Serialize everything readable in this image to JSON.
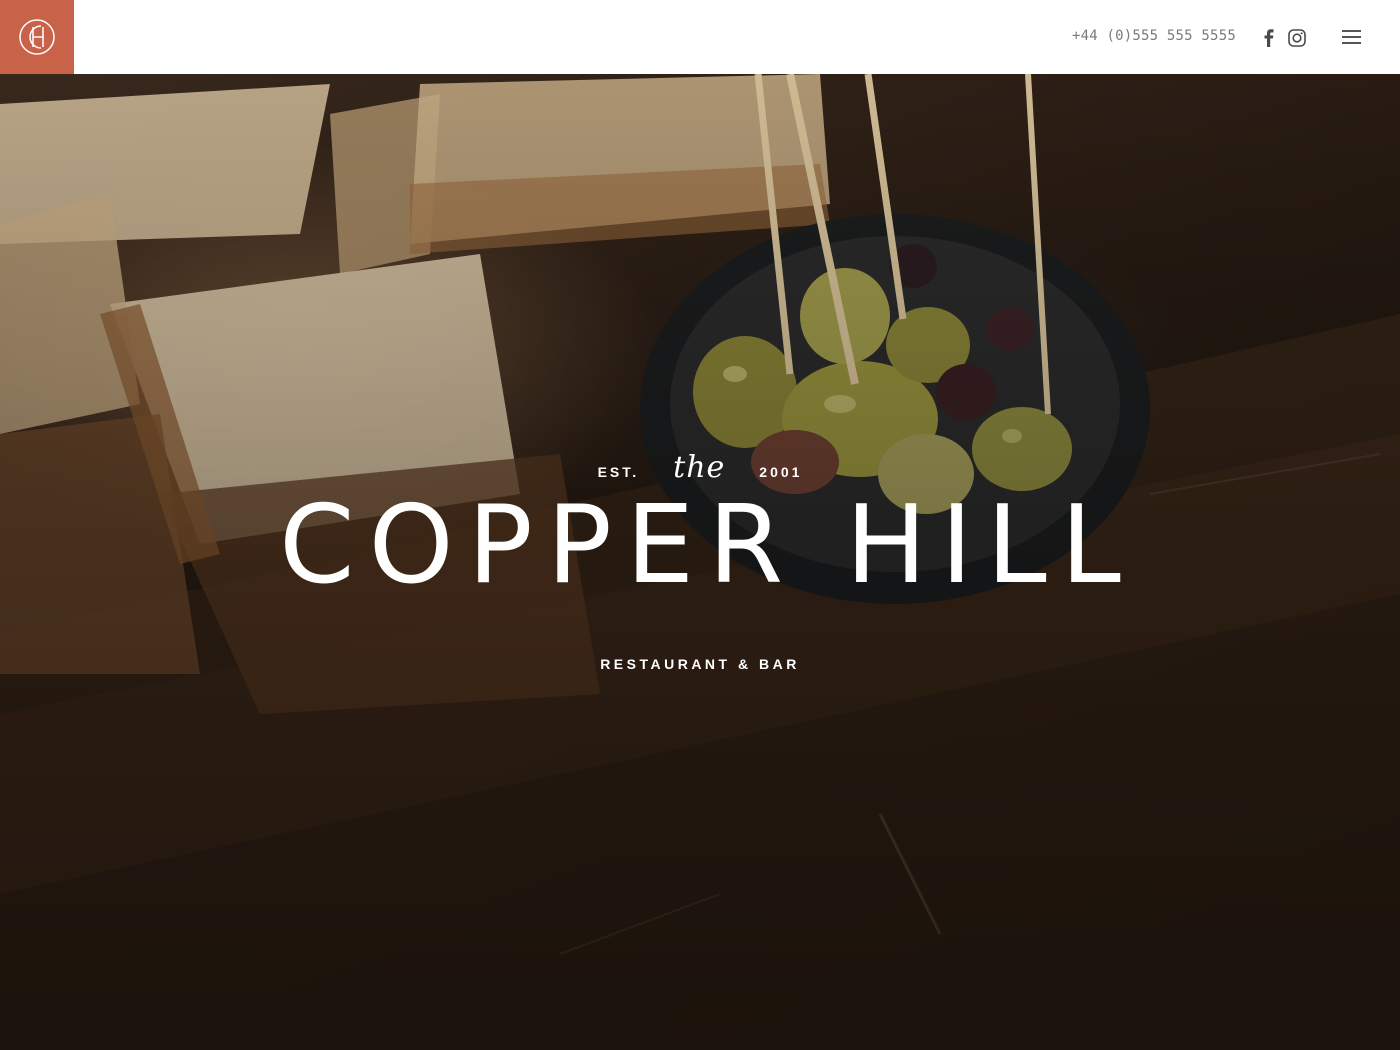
{
  "header": {
    "logo_alt": "CH monogram",
    "phone": "+44 (0)555 555 5555",
    "social": [
      {
        "name": "facebook-icon"
      },
      {
        "name": "instagram-icon"
      }
    ],
    "menu_icon": "hamburger-menu-icon",
    "brand_color": "#c8634a"
  },
  "hero": {
    "est_left": "EST.",
    "est_script": "the",
    "est_right": "2001",
    "title": "COPPER HILL",
    "subtitle": "RESTAURANT & BAR"
  }
}
